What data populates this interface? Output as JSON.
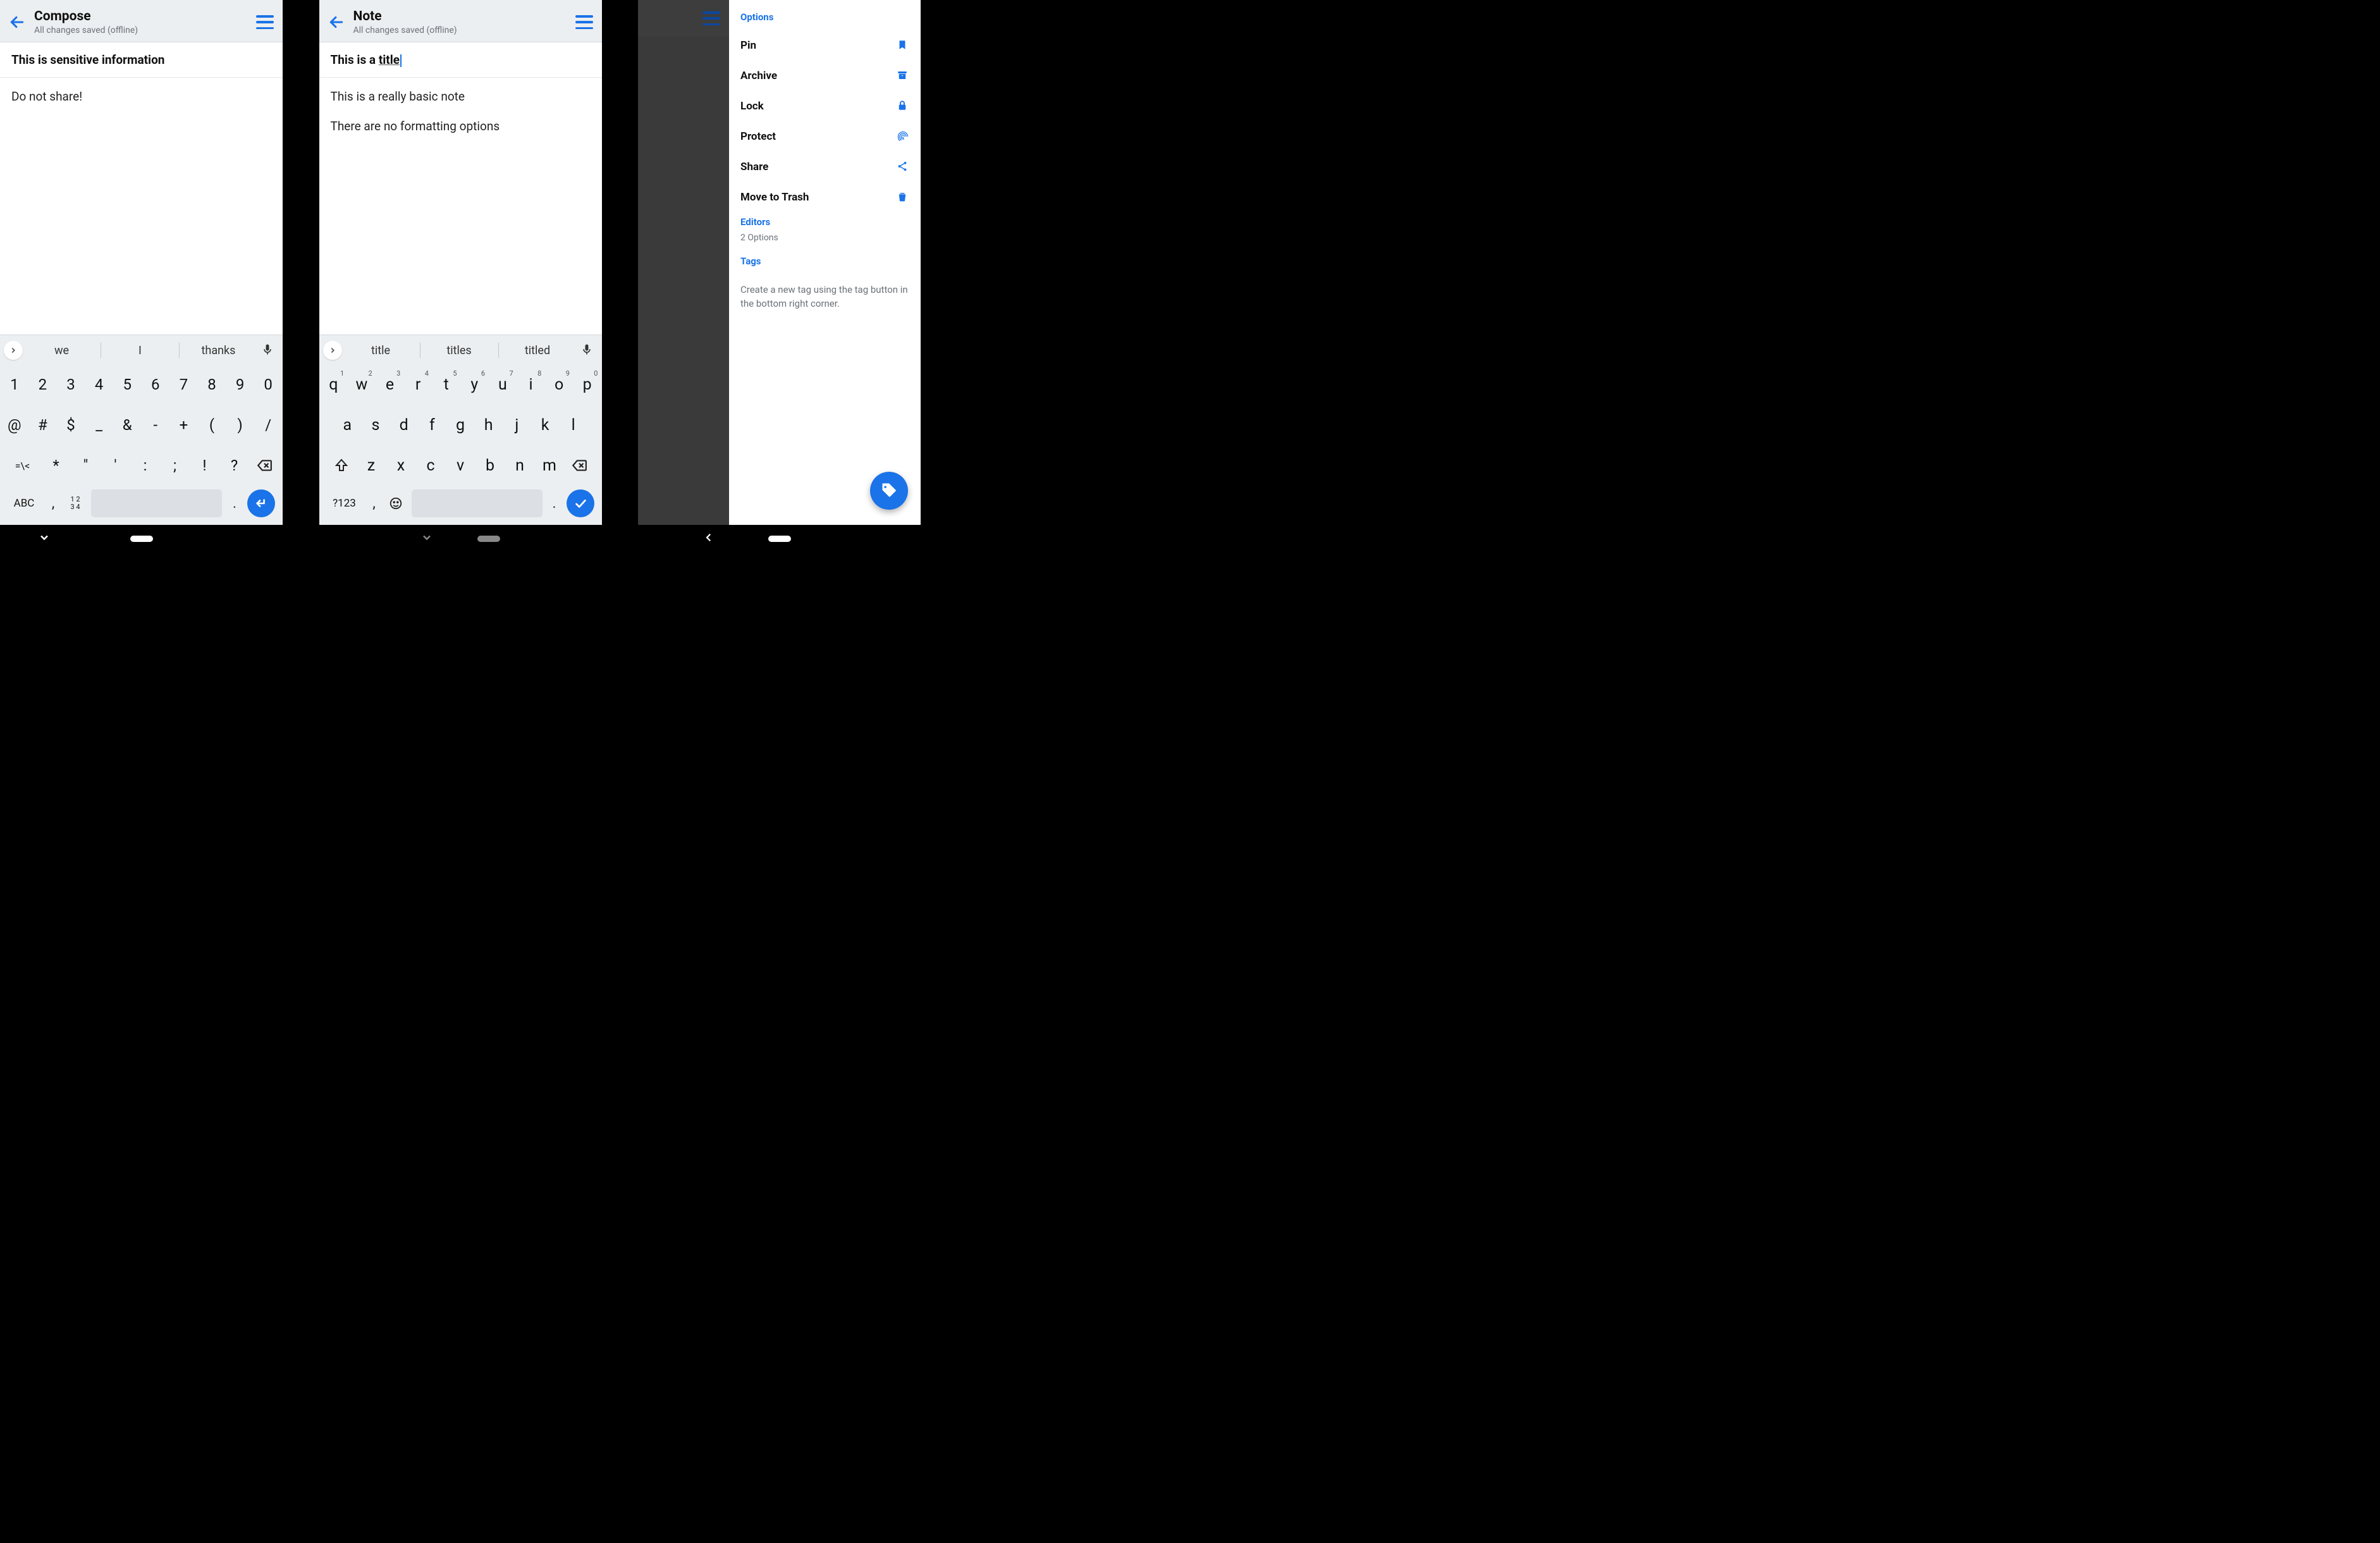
{
  "screen1": {
    "header": {
      "title": "Compose",
      "subtitle": "All changes saved (offline)"
    },
    "note_title": "This is sensitive information",
    "note_body": [
      "Do not share!"
    ],
    "keyboard": {
      "suggestions": [
        "we",
        "I",
        "thanks"
      ],
      "row1": [
        "1",
        "2",
        "3",
        "4",
        "5",
        "6",
        "7",
        "8",
        "9",
        "0"
      ],
      "row2": [
        "@",
        "#",
        "$",
        "_",
        "&",
        "-",
        "+",
        "(",
        ")",
        "/"
      ],
      "row3_lead": "=\\<",
      "row3": [
        "*",
        "\"",
        "'",
        ":",
        ";",
        "!",
        "?"
      ],
      "bottom_mode": "ABC",
      "bottom_num_hint": "1 2\n3 4",
      "comma": ",",
      "period": "."
    }
  },
  "screen2": {
    "header": {
      "title": "Note",
      "subtitle": "All changes saved (offline)"
    },
    "note_title_prefix": "This is a ",
    "note_title_underlined": "title",
    "note_body": [
      "This is a really basic note",
      "There are no formatting options"
    ],
    "keyboard": {
      "suggestions": [
        "title",
        "titles",
        "titled"
      ],
      "row1": [
        "q",
        "w",
        "e",
        "r",
        "t",
        "y",
        "u",
        "i",
        "o",
        "p"
      ],
      "row1_hints": [
        "1",
        "2",
        "3",
        "4",
        "5",
        "6",
        "7",
        "8",
        "9",
        "0"
      ],
      "row2": [
        "a",
        "s",
        "d",
        "f",
        "g",
        "h",
        "j",
        "k",
        "l"
      ],
      "row3": [
        "z",
        "x",
        "c",
        "v",
        "b",
        "n",
        "m"
      ],
      "bottom_mode": "?123",
      "comma": ",",
      "period": "."
    }
  },
  "screen3": {
    "section_options": "Options",
    "items": [
      {
        "label": "Pin",
        "icon": "bookmark-icon"
      },
      {
        "label": "Archive",
        "icon": "archive-icon"
      },
      {
        "label": "Lock",
        "icon": "lock-icon"
      },
      {
        "label": "Protect",
        "icon": "fingerprint-icon"
      },
      {
        "label": "Share",
        "icon": "share-icon"
      },
      {
        "label": "Move to Trash",
        "icon": "trash-icon"
      }
    ],
    "section_editors": "Editors",
    "editors_sub": "2 Options",
    "section_tags": "Tags",
    "tags_hint": "Create a new tag using the tag button in the bottom right corner."
  }
}
